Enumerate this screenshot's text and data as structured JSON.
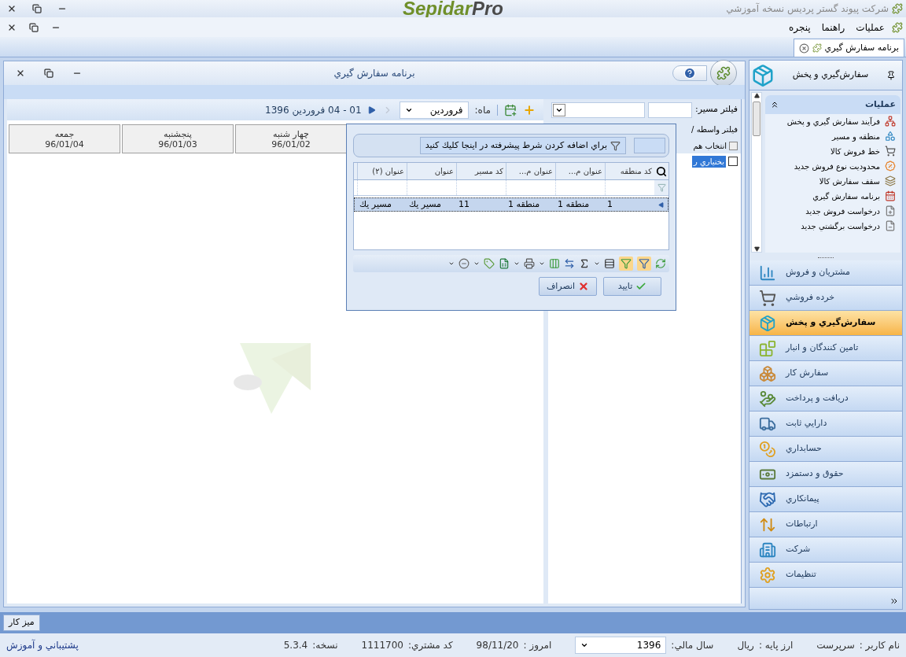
{
  "app": {
    "title": "شرکت پیوند گستر پردیس نسخه آموزشي",
    "logo": {
      "main": "Sepidar",
      "suffix": "Pro"
    }
  },
  "menu": [
    {
      "label": "عمليات"
    },
    {
      "label": "راهنما"
    },
    {
      "label": "پنجره"
    }
  ],
  "doc_tabs": [
    {
      "label": "برنامه سفارش گيري",
      "selected": true
    }
  ],
  "document": {
    "title": "برنامه سفارش گيري",
    "period": "01 - 04 فروردين 1396",
    "month_label": "ماه:",
    "month_value": "فروردين",
    "days": [
      {
        "name": "چهار شنبه",
        "date": "96/01/02"
      },
      {
        "name": "پنجشنبه",
        "date": "96/01/03"
      },
      {
        "name": "جمعه",
        "date": "96/01/04"
      }
    ],
    "route_filter_label": "فيلتر مسير:",
    "vehicle_filter_label": "فيلتر واسطه /",
    "select_all": {
      "label": "انتخاب هم",
      "checked": false
    },
    "vehicles": [
      {
        "label": "بختياري ر",
        "checked": false,
        "selected": true
      }
    ]
  },
  "popup": {
    "filter_hint": "براي اضافه كردن شرط پيشرفته در اينجا كليك كنيد",
    "columns": [
      "كد منطقه",
      "عنوان م...",
      "عنوان م...",
      "كد مسير",
      "عنوان",
      "عنوان (۲)"
    ],
    "rows": [
      {
        "cells": [
          "1",
          "منطقه 1",
          "منطقه 1",
          "11",
          "مسير يك",
          "مسير يك"
        ],
        "selected": true
      }
    ],
    "ok": "تاييد",
    "cancel": "انصراف"
  },
  "nav": {
    "title": "سفارش‌گيري و پخش",
    "group_title": "عمليات",
    "group_expanded": true,
    "tasks": [
      "فرآيند سفارش گيري و پخش",
      "منطقه و مسير",
      "خط فروش كالا",
      "محدوديت نوع فروش جديد",
      "سقف سفارش كالا",
      "برنامه سفارش گيري",
      "درخواست فروش جديد",
      "درخواست برگشتي جديد"
    ],
    "modules": [
      {
        "label": "مشتريان و فروش",
        "selected": false
      },
      {
        "label": "خرده فروشي",
        "selected": false
      },
      {
        "label": "سفارش‌گيري و پخش",
        "selected": true
      },
      {
        "label": "تامين كنندگان و انبار",
        "selected": false
      },
      {
        "label": "سفارش كار",
        "selected": false
      },
      {
        "label": "دريافت و پرداخت",
        "selected": false
      },
      {
        "label": "دارايي ثابت",
        "selected": false
      },
      {
        "label": "حسابداري",
        "selected": false
      },
      {
        "label": "حقوق و دستمزد",
        "selected": false
      },
      {
        "label": "پيمانكاري",
        "selected": false
      },
      {
        "label": "ارتباطات",
        "selected": false
      },
      {
        "label": "شركت",
        "selected": false
      },
      {
        "label": "تنظيمات",
        "selected": false
      }
    ]
  },
  "taskbar": [
    {
      "label": "ميز كار"
    }
  ],
  "status": {
    "user": {
      "label": "نام کاربر :",
      "value": "سرپرست"
    },
    "currency": {
      "label": "ارز پايه :",
      "value": "ريال"
    },
    "fiscal_year": {
      "label": "سال مالي:",
      "value": "1396"
    },
    "today": {
      "label": "امروز :",
      "value": "98/11/20"
    },
    "customer_code": {
      "label": "كد مشتري:",
      "value": "1111700"
    },
    "version": {
      "label": "نسخه:",
      "value": "5.3.4"
    },
    "support_link": "پشتيباني و آموزش"
  }
}
